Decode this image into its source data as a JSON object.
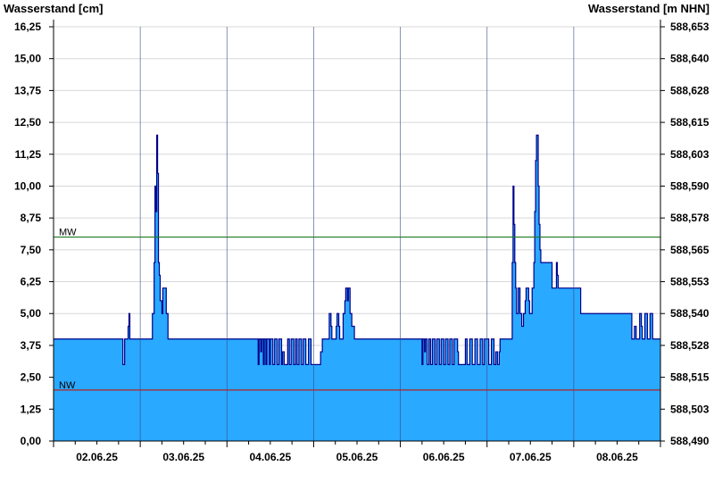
{
  "chart_data": {
    "type": "area",
    "ylabel_left": "Wasserstand [cm]",
    "ylabel_right": "Wasserstand [m NHN]",
    "ylim": [
      0,
      16.25
    ],
    "yticks_left": [
      "0,00",
      "1,25",
      "2,50",
      "3,75",
      "5,00",
      "6,25",
      "7,50",
      "8,75",
      "10,00",
      "11,25",
      "12,50",
      "13,75",
      "15,00",
      "16,25"
    ],
    "yticks_right": [
      "588,490",
      "588,503",
      "588,515",
      "588,528",
      "588,540",
      "588,553",
      "588,565",
      "588,578",
      "588,590",
      "588,603",
      "588,615",
      "588,628",
      "588,640",
      "588,653"
    ],
    "xlim_days": [
      0,
      7
    ],
    "day_labels": [
      "02.06.25",
      "03.06.25",
      "04.06.25",
      "05.06.25",
      "06.06.25",
      "07.06.25",
      "08.06.25"
    ],
    "grid": true,
    "reference_lines": [
      {
        "label": "MW",
        "value": 8.0,
        "color": "#1f7a1f"
      },
      {
        "label": "NW",
        "value": 2.0,
        "color": "#b22222"
      }
    ],
    "fill_color": "#29a9ff",
    "line_color": "#00008b",
    "series": [
      {
        "segments": [
          [
            0,
            4
          ],
          [
            0.8,
            4
          ],
          [
            0.8,
            3
          ],
          [
            0.82,
            3
          ],
          [
            0.82,
            4
          ],
          [
            0.86,
            4
          ],
          [
            0.86,
            4.5
          ],
          [
            0.87,
            4.5
          ],
          [
            0.87,
            5
          ],
          [
            0.88,
            5
          ],
          [
            0.88,
            4
          ],
          [
            1.14,
            4
          ],
          [
            1.14,
            5
          ],
          [
            1.16,
            5
          ],
          [
            1.16,
            7
          ],
          [
            1.17,
            7
          ],
          [
            1.17,
            10
          ],
          [
            1.18,
            10
          ],
          [
            1.18,
            9
          ],
          [
            1.19,
            9
          ],
          [
            1.19,
            12
          ],
          [
            1.2,
            12
          ],
          [
            1.2,
            10.5
          ],
          [
            1.21,
            10.5
          ],
          [
            1.21,
            7
          ],
          [
            1.22,
            7
          ],
          [
            1.22,
            6.5
          ],
          [
            1.23,
            6.5
          ],
          [
            1.23,
            5.5
          ],
          [
            1.25,
            5.5
          ],
          [
            1.25,
            5
          ],
          [
            1.26,
            5
          ],
          [
            1.26,
            6
          ],
          [
            1.3,
            6
          ],
          [
            1.3,
            5
          ],
          [
            1.32,
            5
          ],
          [
            1.32,
            4
          ],
          [
            2.36,
            4
          ],
          [
            2.36,
            3
          ],
          [
            2.37,
            3
          ],
          [
            2.37,
            4
          ],
          [
            2.39,
            4
          ],
          [
            2.39,
            3.5
          ],
          [
            2.4,
            3.5
          ],
          [
            2.4,
            4
          ],
          [
            2.42,
            4
          ],
          [
            2.42,
            3
          ],
          [
            2.43,
            3
          ],
          [
            2.43,
            4
          ],
          [
            2.45,
            4
          ],
          [
            2.45,
            3
          ],
          [
            2.46,
            3
          ],
          [
            2.46,
            4
          ],
          [
            2.49,
            4
          ],
          [
            2.49,
            3
          ],
          [
            2.5,
            3
          ],
          [
            2.5,
            4
          ],
          [
            2.53,
            4
          ],
          [
            2.53,
            3
          ],
          [
            2.55,
            3
          ],
          [
            2.55,
            4
          ],
          [
            2.58,
            4
          ],
          [
            2.58,
            3
          ],
          [
            2.6,
            3
          ],
          [
            2.6,
            4
          ],
          [
            2.63,
            4
          ],
          [
            2.63,
            3
          ],
          [
            2.64,
            3
          ],
          [
            2.64,
            3.5
          ],
          [
            2.66,
            3.5
          ],
          [
            2.66,
            3
          ],
          [
            2.7,
            3
          ],
          [
            2.7,
            4
          ],
          [
            2.72,
            4
          ],
          [
            2.72,
            3
          ],
          [
            2.74,
            3
          ],
          [
            2.74,
            4
          ],
          [
            2.77,
            4
          ],
          [
            2.77,
            3
          ],
          [
            2.79,
            3
          ],
          [
            2.79,
            4
          ],
          [
            2.81,
            4
          ],
          [
            2.81,
            3
          ],
          [
            2.83,
            3
          ],
          [
            2.83,
            4
          ],
          [
            2.86,
            4
          ],
          [
            2.86,
            3
          ],
          [
            2.88,
            3
          ],
          [
            2.88,
            4
          ],
          [
            2.91,
            4
          ],
          [
            2.91,
            3
          ],
          [
            2.94,
            3
          ],
          [
            2.94,
            4
          ],
          [
            2.97,
            4
          ],
          [
            2.97,
            3
          ],
          [
            3.08,
            3
          ],
          [
            3.08,
            3.5
          ],
          [
            3.1,
            3.5
          ],
          [
            3.1,
            4
          ],
          [
            3.18,
            4
          ],
          [
            3.18,
            5
          ],
          [
            3.2,
            5
          ],
          [
            3.2,
            4.5
          ],
          [
            3.21,
            4.5
          ],
          [
            3.21,
            4
          ],
          [
            3.26,
            4
          ],
          [
            3.26,
            4.5
          ],
          [
            3.27,
            4.5
          ],
          [
            3.27,
            5
          ],
          [
            3.29,
            5
          ],
          [
            3.29,
            4.5
          ],
          [
            3.3,
            4.5
          ],
          [
            3.3,
            4
          ],
          [
            3.34,
            4
          ],
          [
            3.34,
            5
          ],
          [
            3.36,
            5
          ],
          [
            3.36,
            5.5
          ],
          [
            3.37,
            5.5
          ],
          [
            3.37,
            6
          ],
          [
            3.39,
            6
          ],
          [
            3.39,
            5.5
          ],
          [
            3.4,
            5.5
          ],
          [
            3.4,
            6
          ],
          [
            3.42,
            6
          ],
          [
            3.42,
            5
          ],
          [
            3.44,
            5
          ],
          [
            3.44,
            4.5
          ],
          [
            3.47,
            4.5
          ],
          [
            3.47,
            4
          ],
          [
            4.25,
            4
          ],
          [
            4.25,
            3
          ],
          [
            4.26,
            3
          ],
          [
            4.26,
            4
          ],
          [
            4.28,
            4
          ],
          [
            4.28,
            3.5
          ],
          [
            4.29,
            3.5
          ],
          [
            4.29,
            4
          ],
          [
            4.31,
            4
          ],
          [
            4.31,
            3
          ],
          [
            4.33,
            3
          ],
          [
            4.33,
            4
          ],
          [
            4.35,
            4
          ],
          [
            4.35,
            3
          ],
          [
            4.37,
            3
          ],
          [
            4.37,
            4
          ],
          [
            4.4,
            4
          ],
          [
            4.4,
            3
          ],
          [
            4.42,
            3
          ],
          [
            4.42,
            4
          ],
          [
            4.45,
            4
          ],
          [
            4.45,
            3
          ],
          [
            4.47,
            3
          ],
          [
            4.47,
            4
          ],
          [
            4.5,
            4
          ],
          [
            4.5,
            3
          ],
          [
            4.52,
            3
          ],
          [
            4.52,
            4
          ],
          [
            4.55,
            4
          ],
          [
            4.55,
            3
          ],
          [
            4.57,
            3
          ],
          [
            4.57,
            4
          ],
          [
            4.6,
            4
          ],
          [
            4.6,
            3
          ],
          [
            4.62,
            3
          ],
          [
            4.62,
            4
          ],
          [
            4.66,
            4
          ],
          [
            4.66,
            3.5
          ],
          [
            4.67,
            3.5
          ],
          [
            4.67,
            3
          ],
          [
            4.75,
            3
          ],
          [
            4.75,
            4
          ],
          [
            4.77,
            4
          ],
          [
            4.77,
            3
          ],
          [
            4.8,
            3
          ],
          [
            4.8,
            4
          ],
          [
            4.83,
            4
          ],
          [
            4.83,
            3
          ],
          [
            4.86,
            3
          ],
          [
            4.86,
            4
          ],
          [
            4.89,
            4
          ],
          [
            4.89,
            3
          ],
          [
            4.92,
            3
          ],
          [
            4.92,
            4
          ],
          [
            4.95,
            4
          ],
          [
            4.95,
            3
          ],
          [
            4.97,
            3
          ],
          [
            4.97,
            4
          ],
          [
            5.02,
            4
          ],
          [
            5.02,
            3
          ],
          [
            5.05,
            3
          ],
          [
            5.05,
            4
          ],
          [
            5.08,
            4
          ],
          [
            5.08,
            3
          ],
          [
            5.1,
            3
          ],
          [
            5.1,
            3.5
          ],
          [
            5.12,
            3.5
          ],
          [
            5.12,
            3
          ],
          [
            5.14,
            3
          ],
          [
            5.14,
            3.5
          ],
          [
            5.15,
            3.5
          ],
          [
            5.15,
            4
          ],
          [
            5.29,
            4
          ],
          [
            5.29,
            7
          ],
          [
            5.3,
            7
          ],
          [
            5.3,
            10
          ],
          [
            5.31,
            10
          ],
          [
            5.31,
            8.5
          ],
          [
            5.32,
            8.5
          ],
          [
            5.32,
            7
          ],
          [
            5.33,
            7
          ],
          [
            5.33,
            6
          ],
          [
            5.34,
            6
          ],
          [
            5.34,
            5
          ],
          [
            5.36,
            5
          ],
          [
            5.36,
            6
          ],
          [
            5.38,
            6
          ],
          [
            5.38,
            5
          ],
          [
            5.4,
            5
          ],
          [
            5.4,
            4.5
          ],
          [
            5.42,
            4.5
          ],
          [
            5.42,
            5
          ],
          [
            5.44,
            5
          ],
          [
            5.44,
            5.5
          ],
          [
            5.45,
            5.5
          ],
          [
            5.45,
            6
          ],
          [
            5.48,
            6
          ],
          [
            5.48,
            5.5
          ],
          [
            5.49,
            5.5
          ],
          [
            5.49,
            5
          ],
          [
            5.52,
            5
          ],
          [
            5.52,
            6
          ],
          [
            5.54,
            6
          ],
          [
            5.54,
            7
          ],
          [
            5.55,
            7
          ],
          [
            5.55,
            9
          ],
          [
            5.56,
            9
          ],
          [
            5.56,
            11
          ],
          [
            5.57,
            11
          ],
          [
            5.57,
            12
          ],
          [
            5.59,
            12
          ],
          [
            5.59,
            10
          ],
          [
            5.6,
            10
          ],
          [
            5.6,
            8.5
          ],
          [
            5.61,
            8.5
          ],
          [
            5.61,
            7.5
          ],
          [
            5.62,
            7.5
          ],
          [
            5.62,
            7
          ],
          [
            5.75,
            7
          ],
          [
            5.75,
            6
          ],
          [
            5.8,
            6
          ],
          [
            5.8,
            7
          ],
          [
            5.81,
            7
          ],
          [
            5.81,
            6.5
          ],
          [
            5.82,
            6.5
          ],
          [
            5.82,
            6
          ],
          [
            6.08,
            6
          ],
          [
            6.08,
            5
          ],
          [
            6.67,
            5
          ],
          [
            6.67,
            4
          ],
          [
            6.7,
            4
          ],
          [
            6.7,
            4.5
          ],
          [
            6.72,
            4.5
          ],
          [
            6.72,
            4
          ],
          [
            6.76,
            4
          ],
          [
            6.76,
            5
          ],
          [
            6.78,
            5
          ],
          [
            6.78,
            4.5
          ],
          [
            6.79,
            4.5
          ],
          [
            6.79,
            4
          ],
          [
            6.82,
            4
          ],
          [
            6.82,
            5
          ],
          [
            6.85,
            5
          ],
          [
            6.85,
            4
          ],
          [
            6.88,
            4
          ],
          [
            6.88,
            5
          ],
          [
            6.91,
            5
          ],
          [
            6.91,
            4
          ],
          [
            7,
            4
          ]
        ]
      }
    ]
  }
}
